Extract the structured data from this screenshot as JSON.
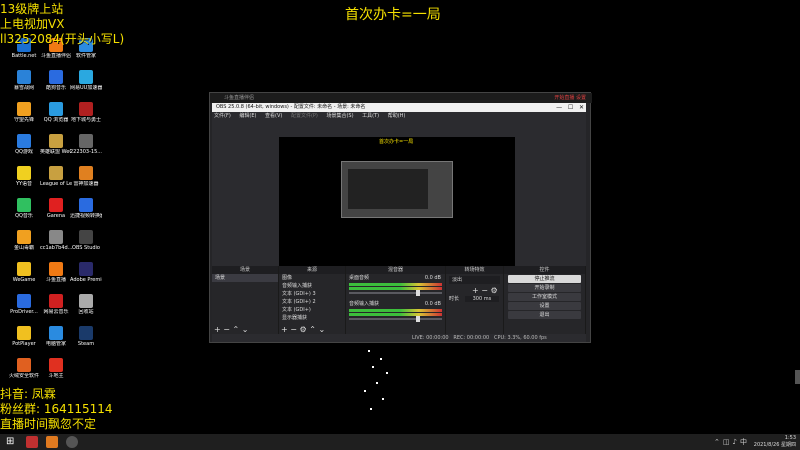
{
  "stream_overlay": {
    "title_banner": "首次办卡=一局",
    "top_lines": [
      "13级牌上站",
      "上电视加VX",
      "ll3252084(开头小写L)"
    ],
    "bottom_lines": [
      "抖音: 凤霖",
      "粉丝群: 164115114",
      "直播时间飘忽不定"
    ]
  },
  "desktop_icons": [
    {
      "label": "Battle.net",
      "color": "#1a6fd1"
    },
    {
      "label": "斗鱼直播伴侣",
      "color": "#f07a14"
    },
    {
      "label": "软件管家",
      "color": "#2c8be0"
    },
    {
      "label": "暴雪战网",
      "color": "#2a82d8"
    },
    {
      "label": "酷狗音乐",
      "color": "#2a6be0"
    },
    {
      "label": "网易UU加速器",
      "color": "#2aa8e0"
    },
    {
      "label": "守望先锋",
      "color": "#f0a020"
    },
    {
      "label": "QQ 浏览器",
      "color": "#2a9be0"
    },
    {
      "label": "地下城与勇士",
      "color": "#b02020"
    },
    {
      "label": "QQ游戏",
      "color": "#2a7be0"
    },
    {
      "label": "英雄联盟 WeGame版",
      "color": "#c8a040"
    },
    {
      "label": "222303-15...",
      "color": "#666666"
    },
    {
      "label": "YY语音",
      "color": "#f0d020"
    },
    {
      "label": "League of Legends",
      "color": "#c8a040"
    },
    {
      "label": "雷神加速器",
      "color": "#e08020"
    },
    {
      "label": "QQ音乐",
      "color": "#30c060"
    },
    {
      "label": "Garena",
      "color": "#e02020"
    },
    {
      "label": "迅捷视频转换器",
      "color": "#2a6be0"
    },
    {
      "label": "金山毒霸",
      "color": "#f0a020"
    },
    {
      "label": "cc1ab7b4d...",
      "color": "#888888"
    },
    {
      "label": "OBS Studio",
      "color": "#444444"
    },
    {
      "label": "WeGame",
      "color": "#f0c020"
    },
    {
      "label": "斗鱼直播",
      "color": "#f07a14"
    },
    {
      "label": "Adobe Premie...",
      "color": "#2a2a6a"
    },
    {
      "label": "ProDriver...",
      "color": "#2a6be0"
    },
    {
      "label": "网易云音乐",
      "color": "#d02020"
    },
    {
      "label": "回收站",
      "color": "#aaaaaa"
    },
    {
      "label": "PotPlayer",
      "color": "#f0c020"
    },
    {
      "label": "电脑管家",
      "color": "#2a8be0"
    },
    {
      "label": "Steam",
      "color": "#1a3a6a"
    },
    {
      "label": "火绒安全软件",
      "color": "#e06020"
    },
    {
      "label": "斗地主",
      "color": "#e03020"
    }
  ],
  "obs_window": {
    "outer_title": "斗鱼直播伴侣",
    "outer_right": "开始直播  设置",
    "title": "OBS 25.0.8 (64-bit, windows) - 配置文件: 未命名 - 场景: 未命名",
    "min_icon": "minimize-icon",
    "max_icon": "maximize-icon",
    "close_icon": "close-icon",
    "menu": [
      "文件(F)",
      "编辑(E)",
      "查看(V)",
      "配置文件(P)",
      "场景集合(S)",
      "工具(T)",
      "帮助(H)"
    ],
    "preview_title": "首次办卡=一局",
    "docks": {
      "scenes": {
        "header": "场景",
        "items": [
          "场景"
        ]
      },
      "sources": {
        "header": "来源",
        "items": [
          "图像",
          "音频输入捕获",
          "文本 (GDI+) 3",
          "文本 (GDI+) 2",
          "文本 (GDI+)",
          "显示器捕获"
        ]
      },
      "mixer": {
        "header": "混音器",
        "channels": [
          {
            "name": "桌面音频",
            "db": "0.0 dB",
            "level": 0.72
          },
          {
            "name": "音频输入捕获",
            "db": "0.0 dB",
            "level": 0.72
          }
        ]
      },
      "transitions": {
        "header": "转场特效",
        "type": "淡出",
        "duration_label": "时长",
        "duration_value": "300 ms"
      },
      "controls": {
        "header": "控件",
        "buttons": [
          "停止推流",
          "开始录制",
          "工作室模式",
          "设置",
          "退出"
        ],
        "active_index": 0
      }
    },
    "status": {
      "live": "LIVE: 00:00:00",
      "rec": "REC: 00:00:00",
      "cpu": "CPU: 3.3%, 60.00 fps"
    }
  },
  "taskbar": {
    "time": "1:53",
    "date": "2021/8/26 星期四"
  }
}
